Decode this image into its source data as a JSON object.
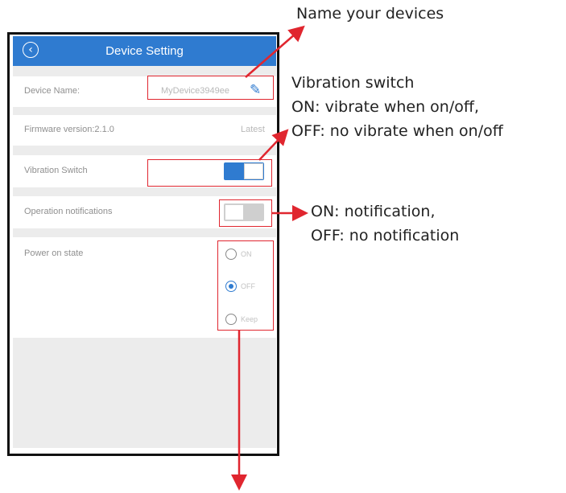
{
  "screen": {
    "title": "Device Setting",
    "rows": {
      "device_name": {
        "label": "Device Name:",
        "value": "MyDevice3949ee"
      },
      "firmware": {
        "label": "Firmware version:2.1.0",
        "value": "Latest"
      },
      "vibration": {
        "label": "Vibration Switch",
        "state": "on"
      },
      "notifications": {
        "label": "Operation notifications",
        "state": "off"
      },
      "power_on": {
        "label": "Power on state",
        "options": [
          "ON",
          "OFF",
          "Keep"
        ],
        "selected": "OFF"
      }
    }
  },
  "annotations": {
    "name_devices": "Name your devices",
    "vibration_line1": "Vibration switch",
    "vibration_line2": "ON: vibrate when on/off,",
    "vibration_line3": "OFF: no vibrate when on/off",
    "notification_line1": "ON: notification,",
    "notification_line2": "OFF: no notification"
  },
  "colors": {
    "accent": "#2f7bd0",
    "annotation_red": "#e0262f"
  }
}
